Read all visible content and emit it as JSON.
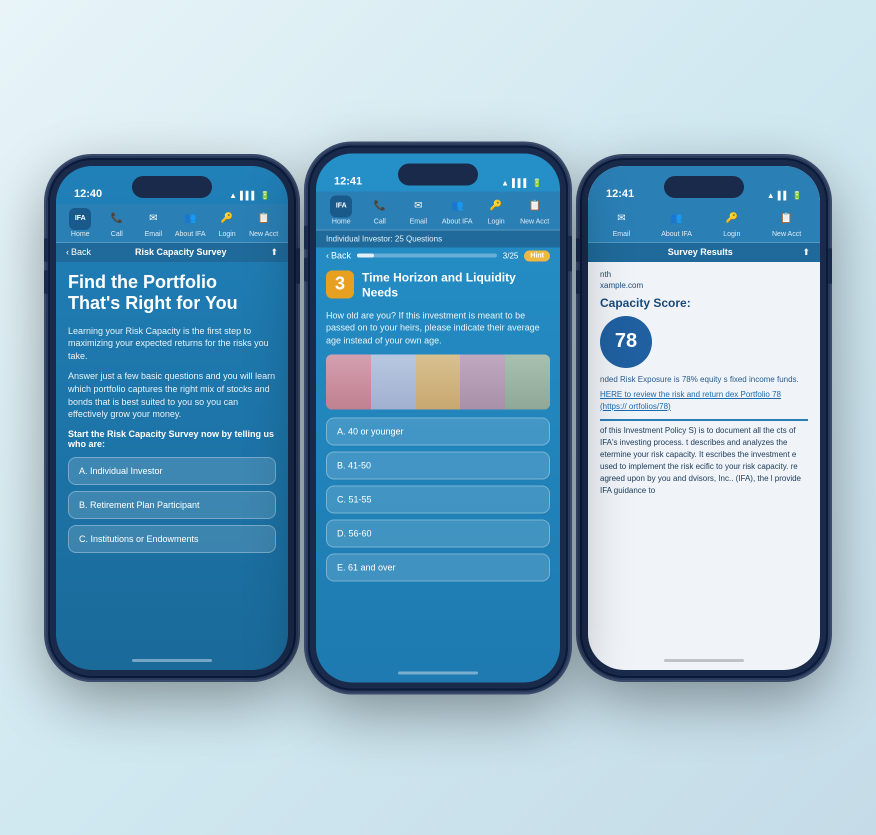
{
  "phones": {
    "left": {
      "time": "12:40",
      "nav_items": [
        {
          "label": "Home",
          "icon": "🏠"
        },
        {
          "label": "Call",
          "icon": "📞"
        },
        {
          "label": "Email",
          "icon": "✉"
        },
        {
          "label": "About IFA",
          "icon": "👥"
        },
        {
          "label": "Login",
          "icon": "🔑"
        },
        {
          "label": "New Acct",
          "icon": "📋"
        }
      ],
      "secondary_nav": {
        "back_label": "Back",
        "title": "Risk Capacity Survey"
      },
      "title_line1": "Find the Portfolio",
      "title_line2": "That's Right for You",
      "body1": "Learning your Risk Capacity is the first step to maximizing your expected returns for the risks you take.",
      "body2": "Answer just a few basic questions and you will learn which portfolio captures the right mix of stocks and bonds that is best suited to you so you can effectively grow your money.",
      "cta": "Start the Risk Capacity Survey now by telling us who are:",
      "answers": [
        {
          "label": "A. Individual Investor"
        },
        {
          "label": "B. Retirement Plan Participant"
        },
        {
          "label": "C. Institutions or Endowments"
        }
      ]
    },
    "center": {
      "time": "12:41",
      "nav_items": [
        {
          "label": "Home",
          "icon": "🏠"
        },
        {
          "label": "Call",
          "icon": "📞"
        },
        {
          "label": "Email",
          "icon": "✉"
        },
        {
          "label": "About IFA",
          "icon": "👥"
        },
        {
          "label": "Login",
          "icon": "🔑"
        },
        {
          "label": "New Acct",
          "icon": "📋"
        }
      ],
      "subtitle": "Individual Investor: 25 Questions",
      "progress": {
        "back_label": "Back",
        "current": 3,
        "total": 25,
        "hint_label": "Hint"
      },
      "question_number": "3",
      "question_title": "Time Horizon and Liquidity Needs",
      "question_body": "How old are you? If this investment is meant to be passed on to your heirs, please indicate their average age instead of your own age.",
      "answers": [
        {
          "label": "A. 40 or younger"
        },
        {
          "label": "B. 41-50"
        },
        {
          "label": "C. 51-55"
        },
        {
          "label": "D. 56-60"
        },
        {
          "label": "E. 61 and over"
        }
      ]
    },
    "right": {
      "time": "12:41",
      "nav_items": [
        {
          "label": "Email",
          "icon": "✉"
        },
        {
          "label": "About IFA",
          "icon": "👥"
        },
        {
          "label": "Login",
          "icon": "🔑"
        },
        {
          "label": "New Acct",
          "icon": "📋"
        }
      ],
      "survey_results_title": "Survey Results",
      "name_partial": "nth",
      "email_partial": "xample.com",
      "capacity_score_label": "apacity Score:",
      "score": "78",
      "score_desc": "nded Risk Exposure is 78% equity s fixed income funds.",
      "link_text": "HERE to review the risk and return dex Portfolio 78 (https:// ortfolios/78)",
      "divider": true,
      "body_text": "of this Investment Policy S) is to document all the cts of IFA's investing process. t describes and analyzes the etermine your risk capacity. It escribes the investment e used to implement the risk ecific to your risk capacity. re agreed upon by you and dvisors, Inc.. (IFA), the l provide IFA guidance to"
    }
  }
}
